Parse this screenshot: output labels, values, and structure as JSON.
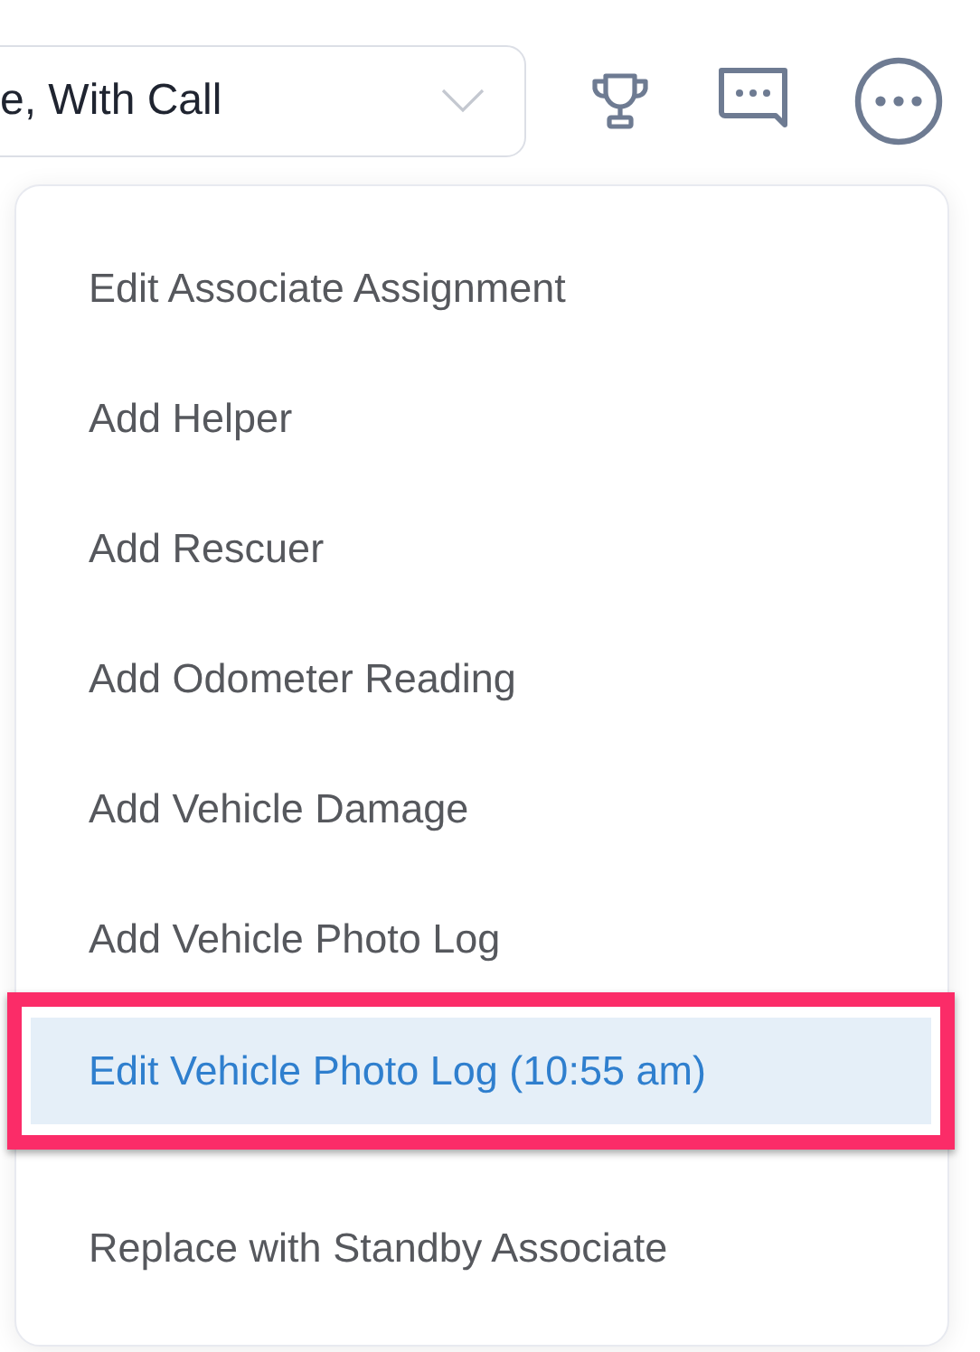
{
  "toolbar": {
    "status_select": {
      "value": "e, With Call"
    }
  },
  "menu": {
    "groups": [
      [
        {
          "label": "Edit Associate Assignment",
          "selected": false
        },
        {
          "label": "Add Helper",
          "selected": false
        },
        {
          "label": "Add Rescuer",
          "selected": false
        },
        {
          "label": "Add Odometer Reading",
          "selected": false
        },
        {
          "label": "Add Vehicle Damage",
          "selected": false
        },
        {
          "label": "Add Vehicle Photo Log",
          "selected": false
        },
        {
          "label": "Edit Vehicle Photo Log (10:55 am)",
          "selected": true
        }
      ],
      [
        {
          "label": "Replace with Standby Associate",
          "selected": false
        }
      ]
    ]
  }
}
